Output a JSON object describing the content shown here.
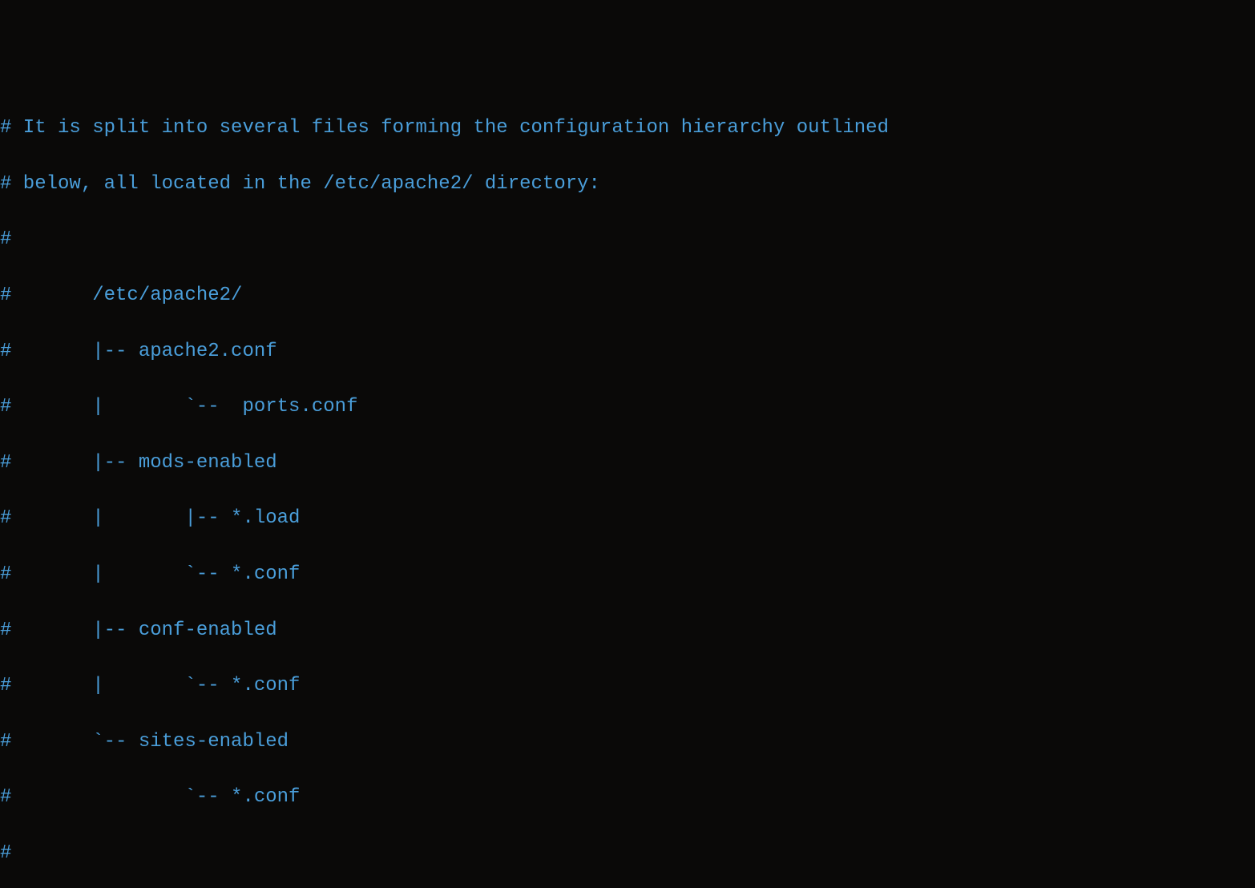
{
  "lines": [
    "# It is split into several files forming the configuration hierarchy outlined",
    "# below, all located in the /etc/apache2/ directory:",
    "#",
    "#       /etc/apache2/",
    "#       |-- apache2.conf",
    "#       |       `--  ports.conf",
    "#       |-- mods-enabled",
    "#       |       |-- *.load",
    "#       |       `-- *.conf",
    "#       |-- conf-enabled",
    "#       |       `-- *.conf",
    "#       `-- sites-enabled",
    "#               `-- *.conf",
    "#"
  ]
}
